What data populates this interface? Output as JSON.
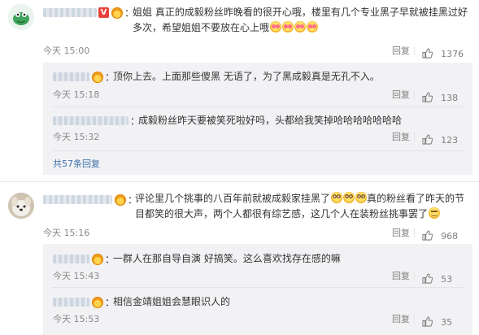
{
  "comments": [
    {
      "text": "姐姐 真正的成毅粉丝昨晚看的很开心哦，楼里有几个专业黑子早就被挂黑过好多次，希望姐姐不要放在心上哦",
      "time": "今天 15:00",
      "reply_label": "回复",
      "likes": "1376",
      "replies": [
        {
          "text": "顶你上去。上面那些傻黑 无语了，为了黑成毅真是无孔不入。",
          "time": "今天 15:18",
          "reply_label": "回复",
          "likes": "138"
        },
        {
          "text": "成毅粉丝昨天要被笑死啦好吗，头都给我笑掉哈哈哈哈哈哈哈",
          "time": "今天 15:32",
          "reply_label": "回复",
          "likes": "123"
        }
      ],
      "more_replies": "共57条回复"
    },
    {
      "text": "评论里几个挑事的八百年前就被成毅家挂黑了",
      "text_after_emoji": "真的粉丝看了昨天的节目都笑的很大声，两个人都很有综艺感，这几个人在装粉丝挑事罢了",
      "time": "今天 15:16",
      "reply_label": "回复",
      "likes": "968",
      "replies": [
        {
          "text": "一群人在那自导自演 好搞笑。这么喜欢找存在感的嘛",
          "time": "今天 15:43",
          "reply_label": "回复",
          "likes": "53"
        },
        {
          "text": "相信金靖姐姐会慧眼识人的",
          "time": "今天 15:53",
          "reply_label": "回复",
          "likes": "35"
        }
      ]
    }
  ],
  "colors": {
    "link": "#3b6fa8",
    "vip_badge": "#e8413d",
    "reply_panel": "#f2f2f5"
  }
}
